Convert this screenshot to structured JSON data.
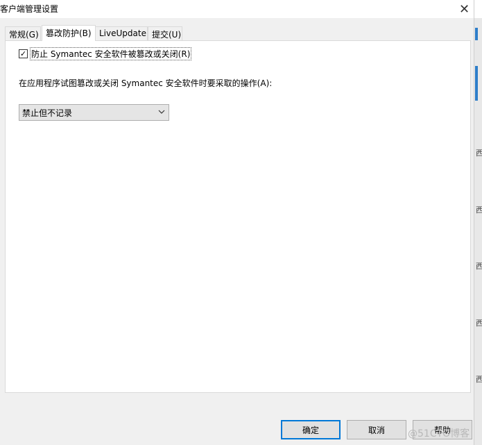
{
  "window": {
    "title": "客户端管理设置",
    "close_symbol": "✕"
  },
  "tabs": [
    {
      "label": "常规(G)"
    },
    {
      "label": "篡改防护(B)"
    },
    {
      "label": "LiveUpdate"
    },
    {
      "label": "提交(U)"
    }
  ],
  "tamper": {
    "protect_checkbox": {
      "label": "防止 Symantec 安全软件被篡改或关闭(R)",
      "checked": true,
      "check_glyph": "✓"
    },
    "action_label": "在应用程序试图篡改或关闭 Symantec 安全软件时要采取的操作(A):",
    "action_select": {
      "selected": "禁止但不记录"
    }
  },
  "buttons": {
    "ok": "确定",
    "cancel": "取消",
    "help": "帮助"
  },
  "background_window": {
    "edge_glyph": "西"
  },
  "watermark": "@51CTO博客",
  "colors": {
    "accent": "#0078d7",
    "panel_bg": "#ffffff",
    "dialog_bg": "#f0f0f0"
  }
}
